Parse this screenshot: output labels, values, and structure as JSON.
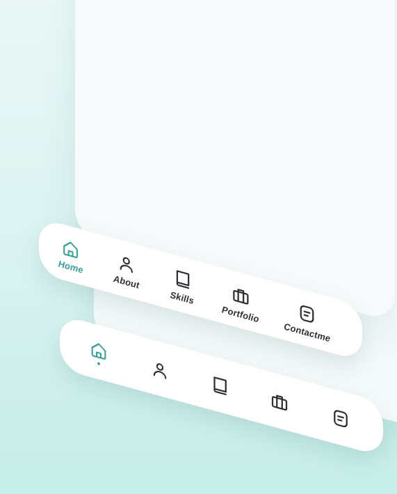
{
  "colors": {
    "accent": "#2fa498",
    "icon": "#2b2f33",
    "navbar_bg": "#ffffff",
    "screen_bg": "#f6fafa"
  },
  "labeled_nav": {
    "items": [
      {
        "label": "Home",
        "icon": "home-icon",
        "active": true
      },
      {
        "label": "About",
        "icon": "user-icon",
        "active": false
      },
      {
        "label": "Skills",
        "icon": "book-icon",
        "active": false
      },
      {
        "label": "Portfolio",
        "icon": "briefcase-icon",
        "active": false
      },
      {
        "label": "Contactme",
        "icon": "note-icon",
        "active": false
      }
    ]
  },
  "icon_nav": {
    "items": [
      {
        "icon": "home-icon",
        "active": true
      },
      {
        "icon": "user-icon",
        "active": false
      },
      {
        "icon": "book-icon",
        "active": false
      },
      {
        "icon": "briefcase-icon",
        "active": false
      },
      {
        "icon": "note-icon",
        "active": false
      }
    ]
  }
}
